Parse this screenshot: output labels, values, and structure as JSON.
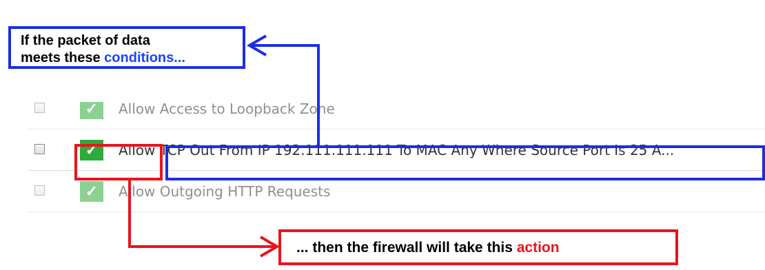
{
  "callouts": {
    "conditions_prefix": "If the packet of data",
    "conditions_line2": "meets these ",
    "conditions_highlight": "conditions...",
    "action_prefix": "... then the firewall will take this ",
    "action_highlight": "action"
  },
  "rules": [
    {
      "label": "Allow Access to Loopback Zone",
      "checked": false,
      "enabled": true
    },
    {
      "label_action": "Allow",
      "label_condition": "TCP Out From IP 192.111.111.111 To MAC Any Where Source Port Is 25 A...",
      "checked": false,
      "enabled": true
    },
    {
      "label": "Allow Outgoing HTTP Requests",
      "checked": false,
      "enabled": true
    }
  ],
  "colors": {
    "blue": "#1a2ee6",
    "red": "#e8141c",
    "green": "#2faa3c"
  },
  "icons": {
    "enabled": "check-icon"
  }
}
